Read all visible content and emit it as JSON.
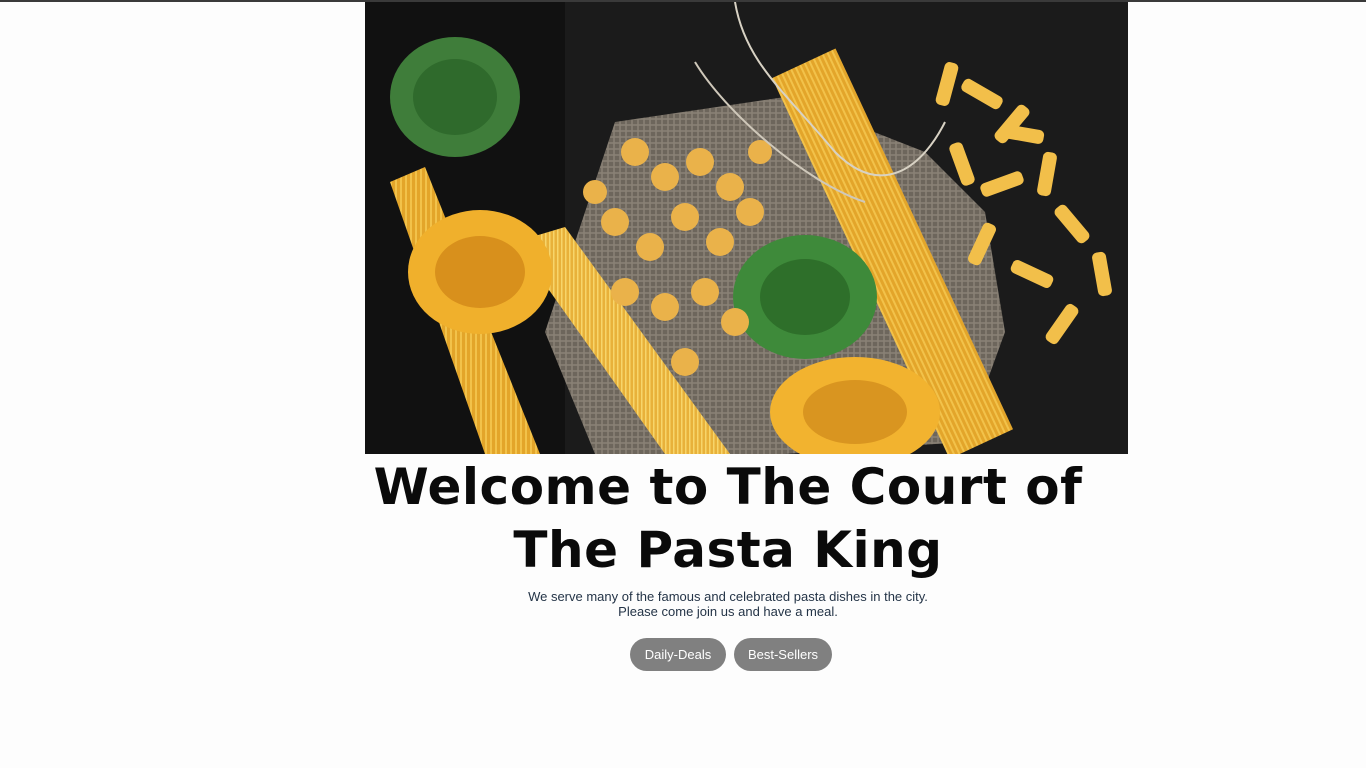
{
  "hero": {
    "image": "pasta-assortment-photo",
    "alt": "Assorted dry pasta on burlap"
  },
  "heading": "Welcome to The Court of The Pasta King",
  "subtitle": {
    "line1": "We serve many of the famous and celebrated pasta dishes in the city.",
    "line2": "Please come join us and have a meal."
  },
  "buttons": {
    "daily_deals": "Daily-Deals",
    "best_sellers": "Best-Sellers"
  },
  "colors": {
    "button_bg": "#808080",
    "button_text": "#ffffff",
    "heading": "#0a0a0a",
    "subtitle": "#243447"
  }
}
